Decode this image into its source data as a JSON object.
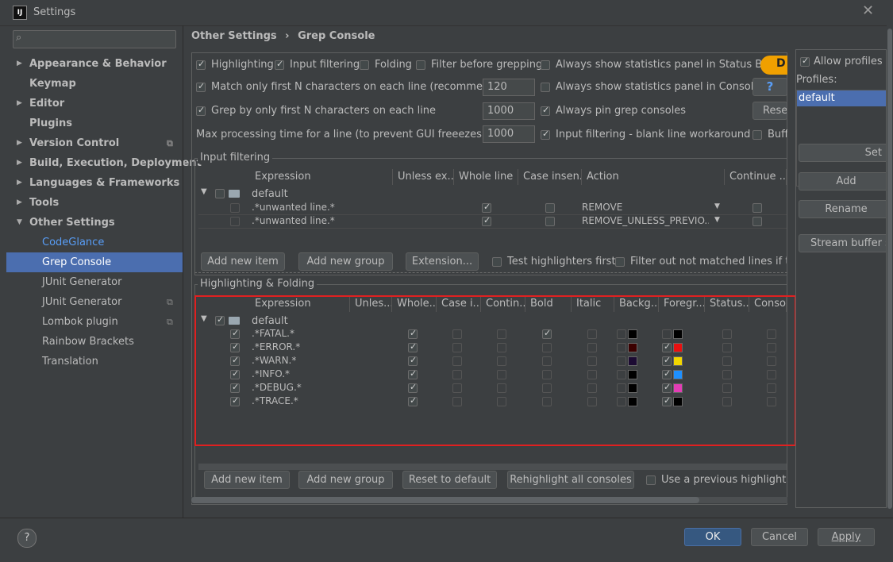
{
  "window": {
    "title": "Settings",
    "app_icon": "IJ"
  },
  "search": {
    "placeholder": ""
  },
  "sidebar": {
    "items": [
      {
        "label": "Appearance & Behavior",
        "arrow": "▶"
      },
      {
        "label": "Keymap"
      },
      {
        "label": "Editor",
        "arrow": "▶"
      },
      {
        "label": "Plugins"
      },
      {
        "label": "Version Control",
        "arrow": "▶"
      },
      {
        "label": "Build, Execution, Deployment",
        "arrow": "▶"
      },
      {
        "label": "Languages & Frameworks",
        "arrow": "▶"
      },
      {
        "label": "Tools",
        "arrow": "▶"
      },
      {
        "label": "Other Settings",
        "arrow": "▼"
      },
      {
        "label": "CodeGlance"
      },
      {
        "label": "Grep Console"
      },
      {
        "label": "JUnit Generator"
      },
      {
        "label": "JUnit Generator"
      },
      {
        "label": "Lombok plugin"
      },
      {
        "label": "Rainbow Brackets"
      },
      {
        "label": "Translation"
      }
    ]
  },
  "breadcrumb": {
    "parent": "Other Settings",
    "sep": "›",
    "current": "Grep Console"
  },
  "options": {
    "highlighting": "Highlighting",
    "input_filtering": "Input filtering",
    "folding": "Folding",
    "filter_before": "Filter before grepping",
    "always_stats_status": "Always show statistics panel in Status Bar",
    "match_first_n": "Match only first N characters on each line (recommended)",
    "match_first_n_value": "120",
    "always_stats_console": "Always show statistics panel in Console",
    "grep_first_n": "Grep by only first N characters on each line",
    "grep_first_n_value": "1000",
    "always_pin": "Always pin grep consoles",
    "max_time": "Max processing time for a line (to prevent GUI freeezes) [ms]",
    "max_time_value": "1000",
    "blank_line": "Input filtering - blank line workaround",
    "reset": "Reset",
    "help_q": "?",
    "buff": "Buffe",
    "donate": "D"
  },
  "input_filtering": {
    "title": "Input filtering",
    "columns": [
      "Expression",
      "Unless ex...",
      "Whole line",
      "Case insen...",
      "Action",
      "Continue ..."
    ],
    "group": "default",
    "rows": [
      {
        "expression": ".*unwanted line.*",
        "action": "REMOVE"
      },
      {
        "expression": ".*unwanted line.*",
        "action": "REMOVE_UNLESS_PREVIO..."
      }
    ],
    "buttons": {
      "add_item": "Add new item",
      "add_group": "Add new group",
      "extension": "Extension..."
    },
    "test_first": "Test highlighters first",
    "filter_out": "Filter out not matched lines if the p"
  },
  "highlighting": {
    "title": "Highlighting & Folding",
    "columns": [
      "Expression",
      "Unles...",
      "Whole...",
      "Case i...",
      "Contin...",
      "Bold",
      "Italic",
      "Backg...",
      "Foregr...",
      "Status...",
      "Conso..."
    ],
    "group": "default",
    "rows": [
      {
        "expression": ".*FATAL.*",
        "bold": true,
        "fg_on": false,
        "bg": "#000000",
        "fg": "#000000"
      },
      {
        "expression": ".*ERROR.*",
        "bold": false,
        "fg_on": true,
        "bg": "#3b0000",
        "fg": "#e81010"
      },
      {
        "expression": ".*WARN.*",
        "bold": false,
        "fg_on": true,
        "bg": "#1c0b33",
        "fg": "#f2d600"
      },
      {
        "expression": ".*INFO.*",
        "bold": false,
        "fg_on": true,
        "bg": "#000000",
        "fg": "#1e90ff"
      },
      {
        "expression": ".*DEBUG.*",
        "bold": false,
        "fg_on": true,
        "bg": "#000000",
        "fg": "#e23db5"
      },
      {
        "expression": ".*TRACE.*",
        "bold": false,
        "fg_on": true,
        "bg": "#000000",
        "fg": "#000000"
      }
    ],
    "buttons": {
      "add_item": "Add new item",
      "add_group": "Add new group",
      "reset_default": "Reset to default",
      "rehighlight": "Rehighlight all consoles"
    },
    "use_previous": "Use a previous highlight if a"
  },
  "profiles": {
    "allow": "Allow profiles in",
    "label": "Profiles:",
    "selected": "default",
    "set": "Set",
    "add": "Add",
    "rename": "Rename",
    "stream_buffer": "Stream buffer se"
  },
  "footer": {
    "ok": "OK",
    "cancel": "Cancel",
    "apply": "Apply",
    "help": "?"
  },
  "colors": {
    "accent": "#4b6eaf",
    "highlight_border": "#e02020",
    "link": "#589df6"
  }
}
